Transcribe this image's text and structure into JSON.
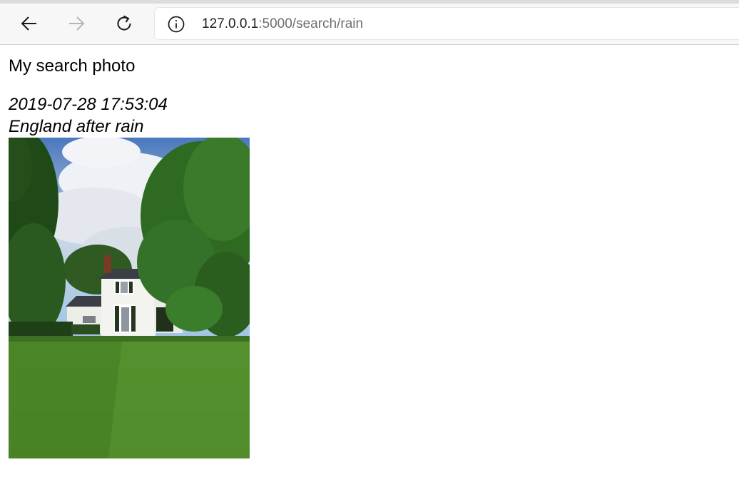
{
  "browser": {
    "url_host": "127.0.0.1",
    "url_path": ":5000/search/rain",
    "icons": {
      "back": "arrow-left-icon",
      "forward": "arrow-right-icon",
      "reload": "reload-icon",
      "site_info": "info-circle-icon"
    }
  },
  "page": {
    "title": "My search photo",
    "photo": {
      "date": "2019-07-28 17:53:04",
      "caption": "England after rain",
      "image_description": "photo-of-white-country-house-with-lawn-and-trees"
    }
  }
}
